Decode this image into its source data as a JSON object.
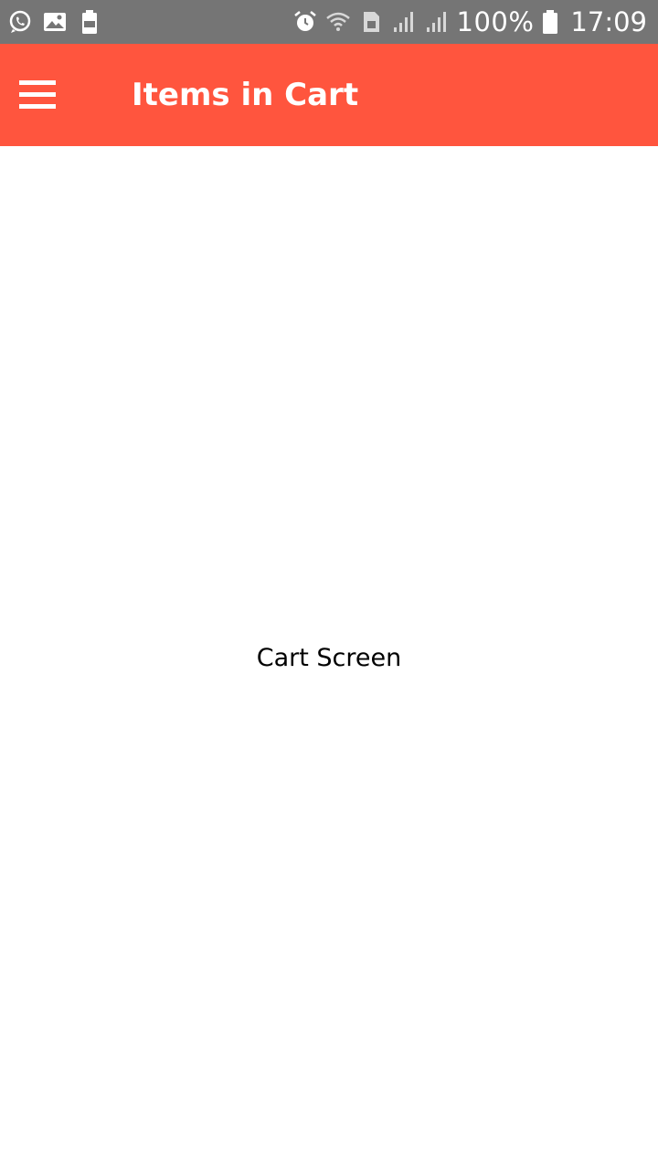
{
  "status_bar": {
    "left_icons": [
      "whatsapp-icon",
      "image-icon",
      "battery-saver-icon"
    ],
    "right_icons": [
      "alarm-icon",
      "wifi-icon",
      "sim-icon",
      "signal-icon",
      "signal-icon",
      "battery-icon"
    ],
    "battery_percent": "100%",
    "time": "17:09"
  },
  "app_bar": {
    "menu_icon": "hamburger-menu-icon",
    "title": "Items in Cart",
    "background_color": "#ff553e"
  },
  "main": {
    "label": "Cart Screen"
  }
}
